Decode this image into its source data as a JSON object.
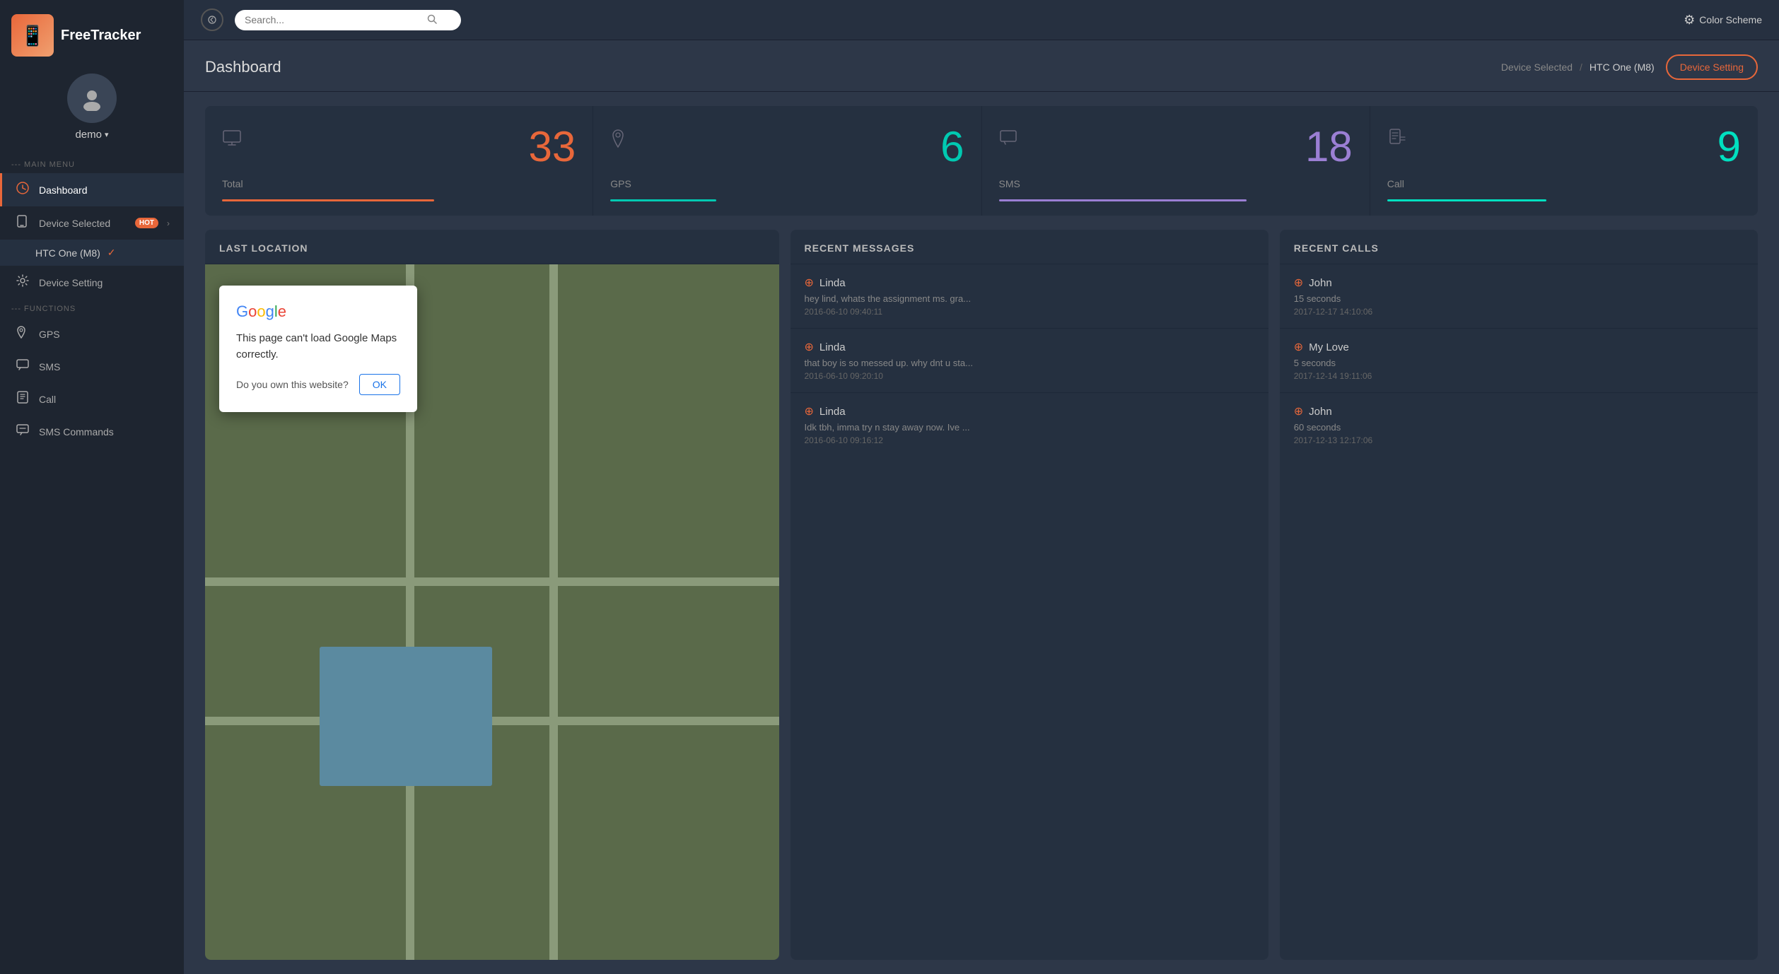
{
  "app": {
    "name": "FreeTracker",
    "logo_emoji": "📱"
  },
  "user": {
    "name": "demo",
    "avatar_icon": "👤"
  },
  "sidebar": {
    "main_menu_label": "--- MAIN MENU",
    "functions_label": "--- FUNCTIONS",
    "items": [
      {
        "id": "dashboard",
        "label": "Dashboard",
        "icon": "clock",
        "active": true
      },
      {
        "id": "device-selected",
        "label": "Device Selected",
        "icon": "device",
        "hot": true,
        "has_arrow": true
      },
      {
        "id": "device-sub",
        "label": "HTC One (M8)",
        "icon": "",
        "is_sub": true,
        "checked": true
      },
      {
        "id": "device-setting",
        "label": "Device Setting",
        "icon": "gear"
      },
      {
        "id": "gps",
        "label": "GPS",
        "icon": "pin"
      },
      {
        "id": "sms",
        "label": "SMS",
        "icon": "chat"
      },
      {
        "id": "call",
        "label": "Call",
        "icon": "phone"
      },
      {
        "id": "sms-commands",
        "label": "SMS Commands",
        "icon": "speech"
      }
    ]
  },
  "topbar": {
    "search_placeholder": "Search...",
    "color_scheme_label": "Color Scheme",
    "back_button_label": "←"
  },
  "header": {
    "title": "Dashboard",
    "breadcrumb_device_selected": "Device Selected",
    "breadcrumb_separator": "/",
    "breadcrumb_device_name": "HTC One (M8)",
    "device_setting_btn": "Device Setting"
  },
  "stats": [
    {
      "id": "total",
      "icon": "monitor",
      "number": "33",
      "label": "Total",
      "color": "#e8673a",
      "bar_width": "60%"
    },
    {
      "id": "gps",
      "icon": "pin",
      "number": "6",
      "label": "GPS",
      "color": "#00c9b1",
      "bar_width": "30%"
    },
    {
      "id": "sms",
      "icon": "chat",
      "number": "18",
      "label": "SMS",
      "color": "#9b7fd4",
      "bar_width": "70%"
    },
    {
      "id": "call",
      "icon": "phone-log",
      "number": "9",
      "label": "Call",
      "color": "#00e0c0",
      "bar_width": "45%"
    }
  ],
  "last_location": {
    "panel_title": "LAST LOCATION",
    "google_dialog": {
      "logo": "Google",
      "message": "This page can't load Google Maps correctly.",
      "question": "Do you own this website?",
      "ok_label": "OK"
    }
  },
  "recent_messages": {
    "panel_title": "RECENT MESSAGES",
    "items": [
      {
        "contact": "Linda",
        "text": "hey lind, whats the assignment ms. gra...",
        "time": "2016-06-10 09:40:11"
      },
      {
        "contact": "Linda",
        "text": "that boy is so messed up. why dnt u sta...",
        "time": "2016-06-10 09:20:10"
      },
      {
        "contact": "Linda",
        "text": "Idk tbh, imma try n stay away now. Ive ...",
        "time": "2016-06-10 09:16:12"
      }
    ]
  },
  "recent_calls": {
    "panel_title": "RECENT CALLS",
    "items": [
      {
        "contact": "John",
        "duration": "15 seconds",
        "time": "2017-12-17 14:10:06"
      },
      {
        "contact": "My Love",
        "duration": "5 seconds",
        "time": "2017-12-14 19:11:06"
      },
      {
        "contact": "John",
        "duration": "60 seconds",
        "time": "2017-12-13 12:17:06"
      }
    ]
  }
}
